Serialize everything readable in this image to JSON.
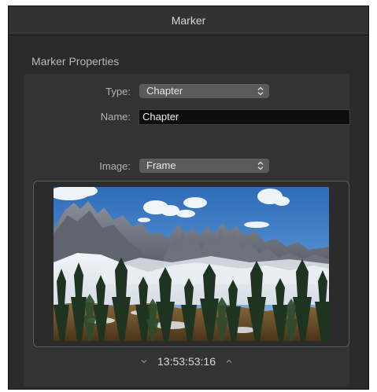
{
  "window": {
    "title": "Marker"
  },
  "section": {
    "title": "Marker Properties"
  },
  "type_field": {
    "label": "Type:",
    "value": "Chapter",
    "icon": "chevron-up-down-icon"
  },
  "name_field": {
    "label": "Name:",
    "value": "Chapter"
  },
  "image_field": {
    "label": "Image:",
    "value": "Frame",
    "icon": "chevron-up-down-icon"
  },
  "timecode": {
    "value": "13:53:53:16",
    "decrement_icon": "chevron-down-icon",
    "increment_icon": "chevron-up-icon"
  },
  "colors": {
    "window_bg": "#2a2a2a",
    "panel_bg": "#333333",
    "popup_bg": "#5a5a5a",
    "text": "#d6d6d6"
  }
}
